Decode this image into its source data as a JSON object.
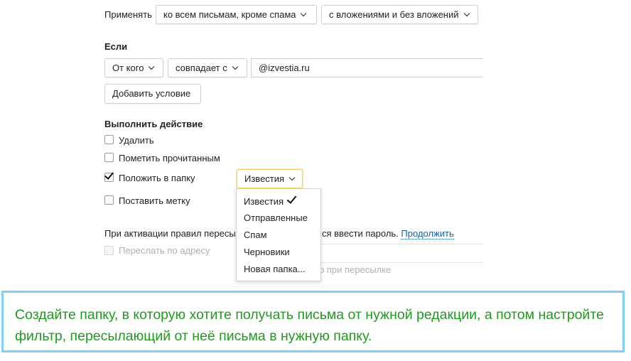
{
  "apply": {
    "label": "Применять",
    "scope_select": "ко всем письмам, кроме спама",
    "attachments_select": "с вложениями и без вложений"
  },
  "condition": {
    "heading": "Если",
    "field_select": "От кого",
    "operator_select": "совпадает с",
    "value": "@izvestia.ru",
    "add_button": "Добавить условие"
  },
  "actions": {
    "heading": "Выполнить действие",
    "delete": {
      "label": "Удалить",
      "checked": false
    },
    "mark_read": {
      "label": "Пометить прочитанным",
      "checked": false
    },
    "move_to_folder": {
      "label": "Положить в папку",
      "checked": true,
      "folder": "Известия"
    },
    "set_label": {
      "label": "Поставить метку",
      "checked": false
    }
  },
  "folder_menu": {
    "items": [
      "Известия",
      "Отправленные",
      "Спам",
      "Черновики",
      "Новая папка..."
    ],
    "selected_index": 0
  },
  "forwarding": {
    "notice_left": "При активации правил пересыл",
    "notice_right": "ся ввести пароль.",
    "continue_link": "Продолжить",
    "forward_label": "Переслать по адресу",
    "save_copy_partial": "о при пересылке"
  },
  "hint": {
    "text": "Создайте папку, в которую хотите получать письма от нужной редакции, а потом настройте фильтр, пересылающий от неё письма в нужную папку."
  },
  "colors": {
    "hint_border": "#7fd0f5",
    "hint_text": "#1e9a1e",
    "link": "#1a5aa0",
    "active_select_border": "#f1d26b"
  }
}
